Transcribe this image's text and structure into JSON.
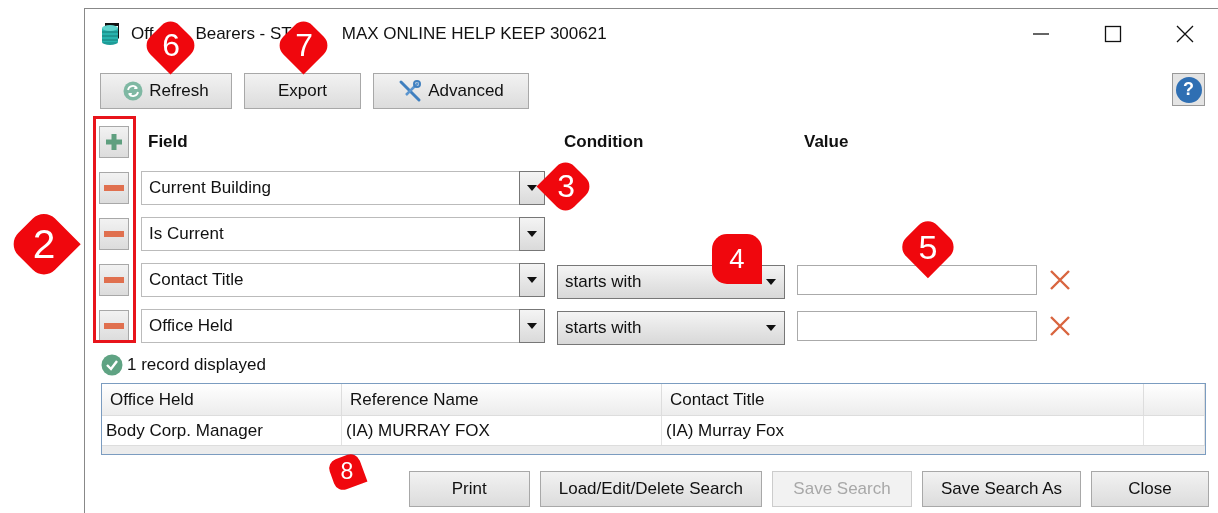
{
  "window": {
    "title_parts": [
      "Off",
      "Bearers - ST",
      "MAX ONLINE HELP KEEP 300621"
    ]
  },
  "toolbar": [
    {
      "label": "Refresh"
    },
    {
      "label": "Export"
    },
    {
      "label": "Advanced"
    }
  ],
  "help_button": {
    "label": "?"
  },
  "filter": {
    "headers": [
      "Field",
      "Condition",
      "Value"
    ],
    "rows": [
      {
        "field": "Current Building"
      },
      {
        "field": "Is Current"
      },
      {
        "field": "Contact Title",
        "condition": "starts with"
      },
      {
        "field": "Office Held",
        "condition": "starts with"
      }
    ]
  },
  "status": {
    "text": "1 record displayed"
  },
  "table": {
    "columns": [
      "Office Held",
      "Reference Name",
      "Contact Title"
    ],
    "rows": [
      [
        "Body Corp. Manager",
        "(IA) MURRAY FOX",
        "(IA) Murray Fox"
      ]
    ]
  },
  "buttons": [
    {
      "label": "Print",
      "disabled": false
    },
    {
      "label": "Load/Edit/Delete Search",
      "disabled": false
    },
    {
      "label": "Save Search",
      "disabled": true
    },
    {
      "label": "Save Search As",
      "disabled": false
    },
    {
      "label": "Close",
      "disabled": false
    }
  ],
  "callouts": [
    {
      "label": "2"
    },
    {
      "label": "3"
    },
    {
      "label": "4"
    },
    {
      "label": "5"
    },
    {
      "label": "6"
    },
    {
      "label": "7"
    },
    {
      "label": "8"
    }
  ]
}
